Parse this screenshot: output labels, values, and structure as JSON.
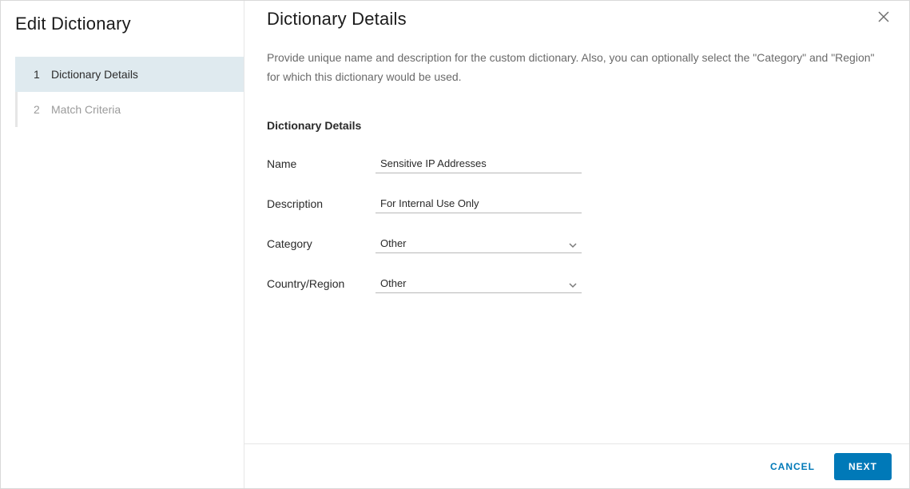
{
  "sidebar": {
    "title": "Edit Dictionary",
    "steps": [
      {
        "number": "1",
        "label": "Dictionary Details",
        "active": true
      },
      {
        "number": "2",
        "label": "Match Criteria",
        "active": false
      }
    ]
  },
  "main": {
    "title": "Dictionary Details",
    "intro": "Provide unique name and description for the custom dictionary. Also, you can optionally select the \"Category\" and \"Region\" for which this dictionary would be used.",
    "section_title": "Dictionary Details",
    "fields": {
      "name_label": "Name",
      "name_value": "Sensitive IP Addresses",
      "description_label": "Description",
      "description_value": "For Internal Use Only",
      "category_label": "Category",
      "category_value": "Other",
      "region_label": "Country/Region",
      "region_value": "Other"
    }
  },
  "footer": {
    "cancel_label": "CANCEL",
    "next_label": "NEXT"
  }
}
